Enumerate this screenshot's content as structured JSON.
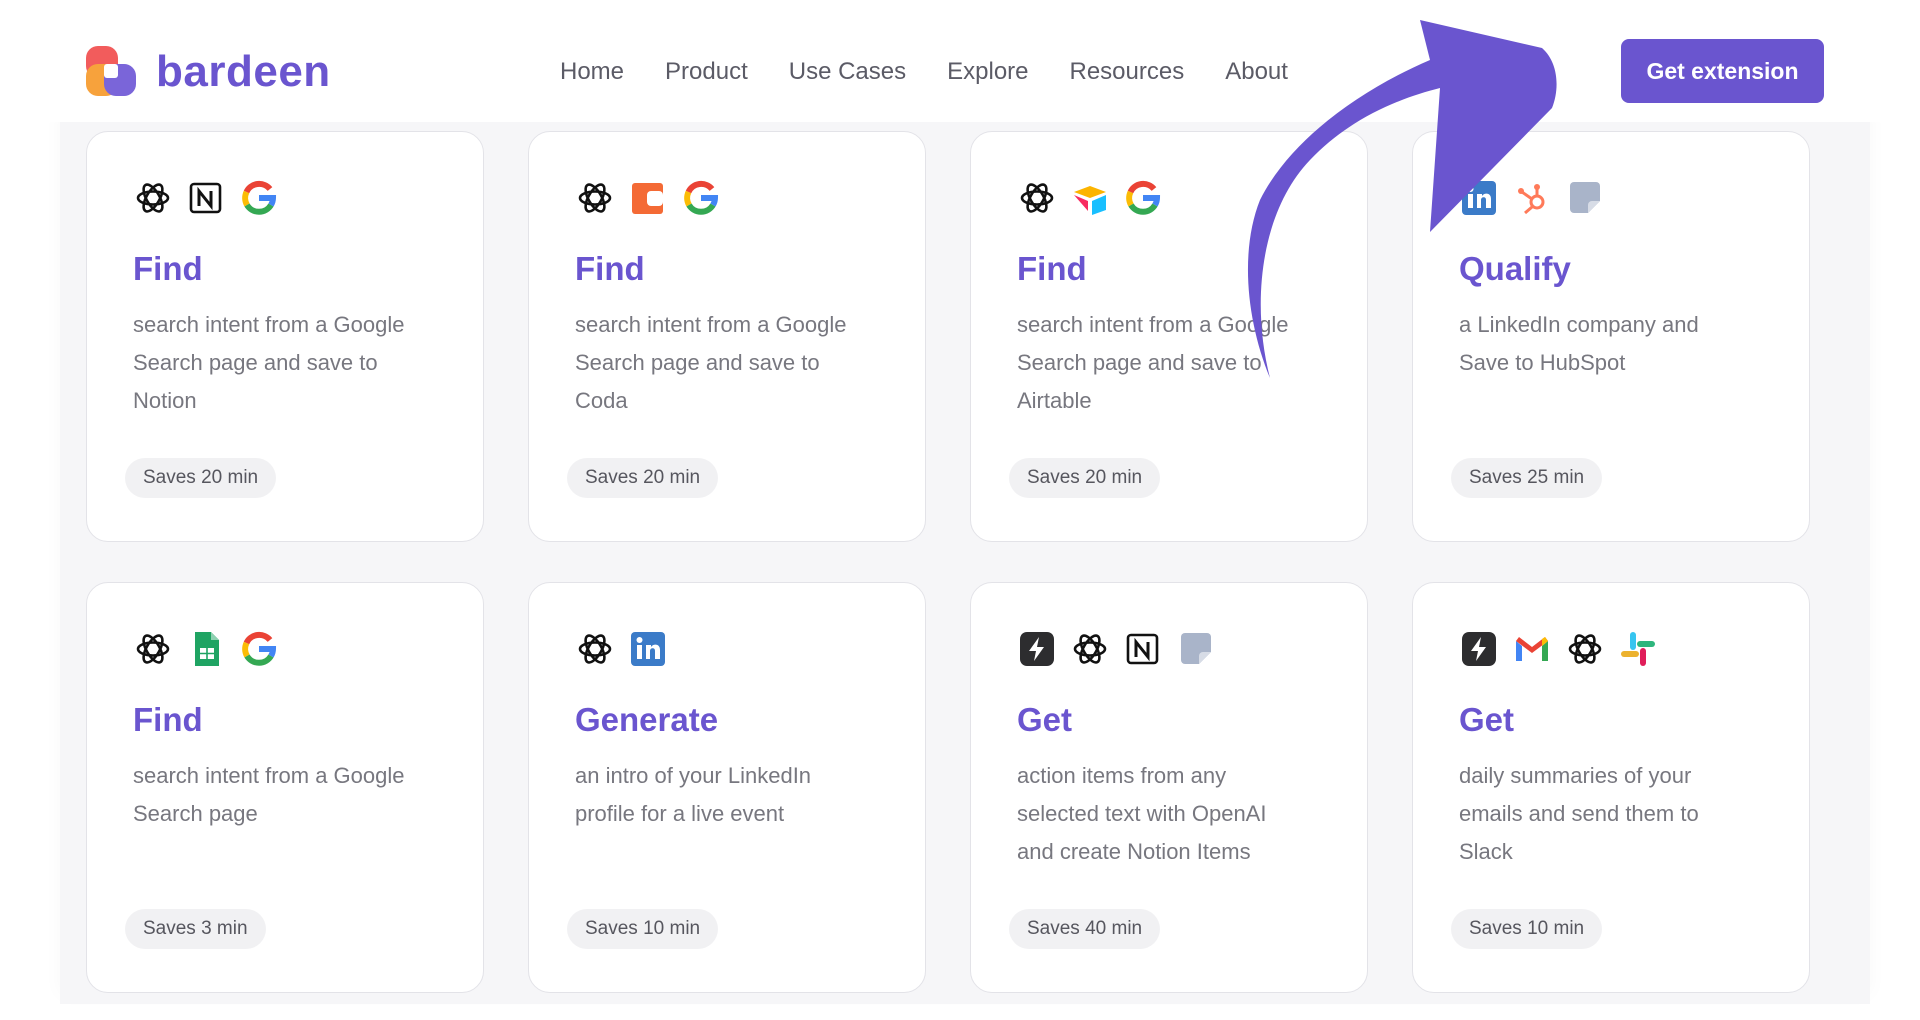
{
  "brand": {
    "name": "bardeen",
    "colors": {
      "accent": "#6a55cf",
      "logo_red": "#f25c5c",
      "logo_orange": "#f7a23c",
      "logo_purple": "#7a65d9"
    }
  },
  "nav": {
    "items": [
      "Home",
      "Product",
      "Use Cases",
      "Explore",
      "Resources",
      "About"
    ],
    "cta_label": "Get extension"
  },
  "cards": [
    {
      "icons": [
        "openai-icon",
        "notion-icon",
        "google-icon"
      ],
      "title": "Find",
      "description": [
        "search intent from a Google",
        "Search page and save to",
        "Notion"
      ],
      "badge": "Saves 20 min"
    },
    {
      "icons": [
        "openai-icon",
        "coda-icon",
        "google-icon"
      ],
      "title": "Find",
      "description": [
        "search intent from a Google",
        "Search page and save to",
        "Coda"
      ],
      "badge": "Saves 20 min"
    },
    {
      "icons": [
        "openai-icon",
        "airtable-icon",
        "google-icon"
      ],
      "title": "Find",
      "description": [
        "search intent from a Google",
        "Search page and save to",
        "Airtable"
      ],
      "badge": "Saves 20 min"
    },
    {
      "icons": [
        "linkedin-icon",
        "hubspot-icon",
        "sticky-note-icon"
      ],
      "title": "Qualify",
      "description": [
        "a LinkedIn company and",
        "Save to HubSpot"
      ],
      "badge": "Saves 25 min"
    },
    {
      "icons": [
        "openai-icon",
        "google-sheets-icon",
        "google-icon"
      ],
      "title": "Find",
      "description": [
        "search intent from a Google",
        "Search page"
      ],
      "badge": "Saves 3 min"
    },
    {
      "icons": [
        "openai-icon",
        "linkedin-icon"
      ],
      "title": "Generate",
      "description": [
        "an intro of your LinkedIn",
        "profile for a live event"
      ],
      "badge": "Saves 10 min"
    },
    {
      "icons": [
        "bolt-icon",
        "openai-icon",
        "notion-icon",
        "sticky-note-icon"
      ],
      "title": "Get",
      "description": [
        "action items from any",
        "selected text with OpenAI",
        "and create Notion Items"
      ],
      "badge": "Saves 40 min"
    },
    {
      "icons": [
        "bolt-icon",
        "gmail-icon",
        "openai-icon",
        "slack-icon"
      ],
      "title": "Get",
      "description": [
        "daily summaries of your",
        "emails and send them to",
        "Slack"
      ],
      "badge": "Saves 10 min"
    }
  ]
}
